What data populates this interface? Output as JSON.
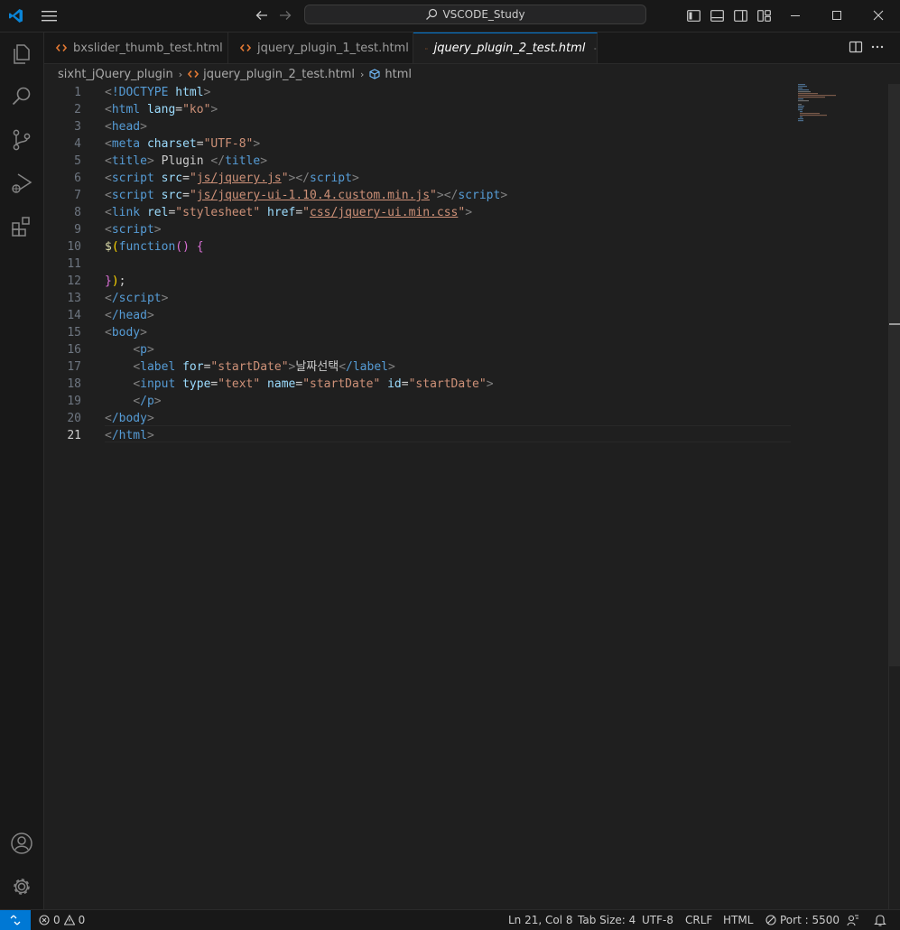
{
  "window": {
    "search_text": "VSCODE_Study"
  },
  "tabs": [
    {
      "label": "bxslider_thumb_test.html",
      "active": false
    },
    {
      "label": "jquery_plugin_1_test.html",
      "active": false
    },
    {
      "label": "jquery_plugin_2_test.html",
      "active": true
    }
  ],
  "breadcrumb": {
    "folder": "sixht_jQuery_plugin",
    "file": "jquery_plugin_2_test.html",
    "symbol": "html"
  },
  "editor": {
    "line_numbers": [
      "1",
      "2",
      "3",
      "4",
      "5",
      "6",
      "7",
      "8",
      "9",
      "10",
      "11",
      "12",
      "13",
      "14",
      "15",
      "16",
      "17",
      "18",
      "19",
      "20",
      "21"
    ],
    "current_line": "21",
    "code": {
      "l1_tag": "!DOCTYPE",
      "l1_attr": "html",
      "l2_tag": "html",
      "l2_attr": "lang",
      "l2_val": "\"ko\"",
      "l3_tag": "head",
      "l4_tag": "meta",
      "l4_attr": "charset",
      "l4_val": "\"UTF-8\"",
      "l5_tag": "title",
      "l5_text": " Plugin ",
      "l5_close": "title",
      "l6_tag": "script",
      "l6_attr": "src",
      "l6_val": "js/jquery.js",
      "l6_close": "script",
      "l7_tag": "script",
      "l7_attr": "src",
      "l7_val": "js/jquery-ui-1.10.4.custom.min.js",
      "l7_close": "script",
      "l8_tag": "link",
      "l8_attr1": "rel",
      "l8_val1": "\"stylesheet\"",
      "l8_attr2": "href",
      "l8_val2": "css/jquery-ui.min.css",
      "l9_tag": "script",
      "l10_dollar": "$",
      "l10_fn": "function",
      "l12_brace": "}",
      "l12_paren": ")",
      "l12_semi": ";",
      "l13_tag": "/script",
      "l14_tag": "/head",
      "l15_tag": "body",
      "l16_tag": "p",
      "l17_tag": "label",
      "l17_attr": "for",
      "l17_val": "\"startDate\"",
      "l17_text": "날짜선택",
      "l17_close": "/label",
      "l18_tag": "input",
      "l18_attr1": "type",
      "l18_val1": "\"text\"",
      "l18_attr2": "name",
      "l18_val2": "\"startDate\"",
      "l18_attr3": "id",
      "l18_val3": "\"startDate\"",
      "l19_tag": "/p",
      "l20_tag": "/body",
      "l21_tag": "/html"
    }
  },
  "status": {
    "errors": "0",
    "warnings": "0",
    "position": "Ln 21, Col 8",
    "tab_size": "Tab Size: 4",
    "encoding": "UTF-8",
    "eol": "CRLF",
    "language": "HTML",
    "port": "Port : 5500"
  },
  "colors": {
    "accent": "#0078d4",
    "tag": "#569cd6",
    "attribute": "#9cdcfe",
    "string": "#ce9178",
    "file_icon": "#e37933"
  },
  "icons": [
    "vscode-logo-icon",
    "menu-icon",
    "arrow-left-icon",
    "arrow-right-icon",
    "search-icon",
    "toggle-primary-sidebar-icon",
    "toggle-panel-icon",
    "toggle-secondary-sidebar-icon",
    "customize-layout-icon",
    "minimize-icon",
    "maximize-icon",
    "close-window-icon",
    "explorer-icon",
    "search-view-icon",
    "source-control-icon",
    "run-debug-icon",
    "extensions-icon",
    "accounts-icon",
    "manage-gear-icon",
    "html-file-icon",
    "split-editor-icon",
    "more-actions-icon",
    "symbol-icon",
    "remote-icon",
    "error-icon",
    "warning-icon",
    "port-icon",
    "feedback-icon",
    "bell-icon"
  ]
}
